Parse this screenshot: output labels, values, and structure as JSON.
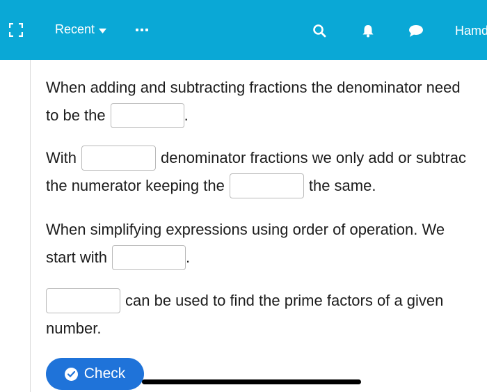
{
  "topbar": {
    "recent_label": "Recent",
    "user_label": "Hamd",
    "background_color": "#0aa8d6"
  },
  "questions": [
    {
      "line1_a": "When adding and subtracting fractions the denominator need",
      "line2_a": "to be the",
      "line2_b": "."
    },
    {
      "line1_a": "With",
      "line1_b": "denominator fractions we only add or subtrac",
      "line2_a": "the numerator keeping the",
      "line2_b": "the same."
    },
    {
      "line1_a": "When simplifying expressions using order of operation. We",
      "line2_a": "start with",
      "line2_b": "."
    },
    {
      "line1_b": "can be used to find the prime factors of a given",
      "line2_a": "number."
    }
  ],
  "blanks": [
    "",
    "",
    "",
    "",
    ""
  ],
  "check_button": {
    "label": "Check",
    "color": "#1f73d9"
  },
  "icons": [
    "expand-icon",
    "chevron-down-icon",
    "more-icon",
    "search-icon",
    "bell-icon",
    "chat-icon",
    "checkmark-icon"
  ]
}
